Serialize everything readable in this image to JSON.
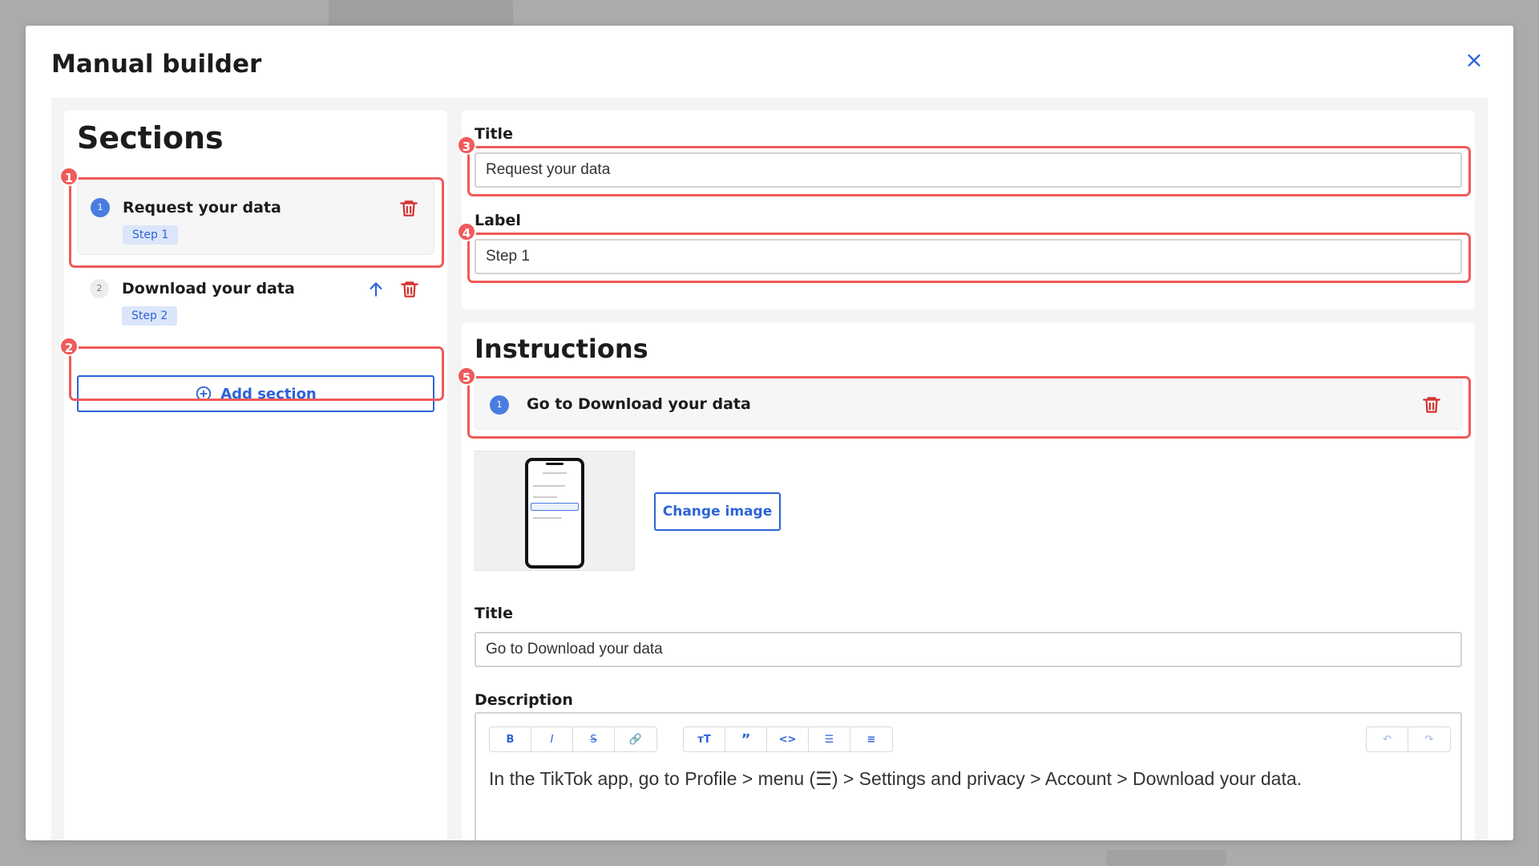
{
  "modal": {
    "title": "Manual builder",
    "close_icon": "×"
  },
  "sections": {
    "heading": "Sections",
    "items": [
      {
        "number": "1",
        "title": "Request your data",
        "badge": "Step 1"
      },
      {
        "number": "2",
        "title": "Download your data",
        "badge": "Step 2"
      }
    ],
    "add_label": "Add section"
  },
  "detail": {
    "title_label": "Title",
    "title_value": "Request your data",
    "label_label": "Label",
    "label_value": "Step 1"
  },
  "instructions": {
    "heading": "Instructions",
    "items": [
      {
        "number": "1",
        "title": "Go to Download your data"
      }
    ],
    "change_image_label": "Change image",
    "title_label": "Title",
    "title_value": "Go to Download your data",
    "description_label": "Description",
    "description_text": "In the TikTok app, go to Profile > menu (☰) > Settings and privacy > Account > Download your data.",
    "toolbar": {
      "format": [
        "B",
        "I",
        "S",
        "🔗"
      ],
      "blocks": [
        "тT",
        "”",
        "<>",
        "☰",
        "≡"
      ],
      "history": [
        "↶",
        "↷"
      ]
    }
  },
  "annotations": [
    "1",
    "2",
    "3",
    "4",
    "5"
  ],
  "colors": {
    "accent": "#2d63d6",
    "danger": "#d32f2f",
    "annotation": "#ef5a5a"
  }
}
